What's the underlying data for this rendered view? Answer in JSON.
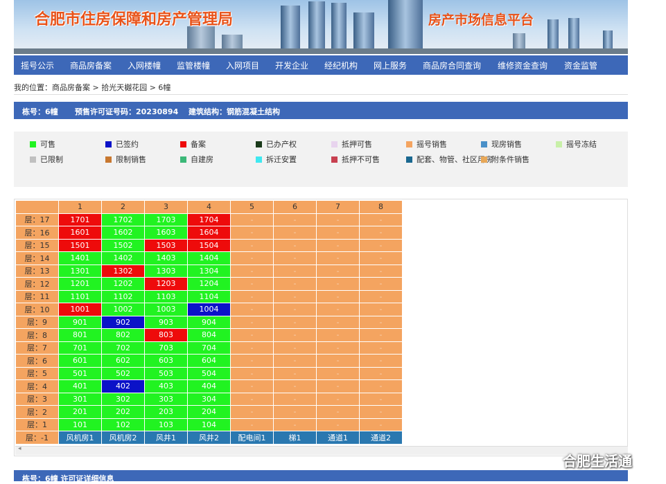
{
  "header": {
    "title": "合肥市住房保障和房产管理局",
    "platform": "房产市场信息平台"
  },
  "nav": [
    "摇号公示",
    "商品房备案",
    "入网楼幢",
    "监管楼幢",
    "入网项目",
    "开发企业",
    "经纪机构",
    "网上服务",
    "商品房合同查询",
    "维修资金查询",
    "资金监管"
  ],
  "breadcrumb": "我的位置：商品房备案 > 拾光天樾花园 > 6幢",
  "info": {
    "building": "栋号：6幢",
    "permit": "预售许可证号码：20230894",
    "structure": "建筑结构：钢筋混凝土结构"
  },
  "legend": [
    {
      "label": "可售",
      "color": "#21f321"
    },
    {
      "label": "已签约",
      "color": "#0b12c8"
    },
    {
      "label": "备案",
      "color": "#ee0b0b"
    },
    {
      "label": "已办产权",
      "color": "#1a3a1a"
    },
    {
      "label": "抵押可售",
      "color": "#e8d4ee"
    },
    {
      "label": "摇号销售",
      "color": "#f4a460"
    },
    {
      "label": "现房销售",
      "color": "#4a90c8"
    },
    {
      "label": "摇号冻结",
      "color": "#c8f0a8"
    },
    {
      "label": "已限制",
      "color": "#c0c0c0"
    },
    {
      "label": "限制销售",
      "color": "#c87830"
    },
    {
      "label": "自建房",
      "color": "#3cb878"
    },
    {
      "label": "拆迁安置",
      "color": "#40e8f0"
    },
    {
      "label": "抵押不可售",
      "color": "#c84050"
    },
    {
      "label": "配套、物管、社区用房",
      "color": "#1a6890"
    },
    {
      "label": "附条件销售",
      "color": "#e8a858"
    }
  ],
  "grid": {
    "columns": [
      "1",
      "2",
      "3",
      "4",
      "5",
      "6",
      "7",
      "8"
    ],
    "empty_mark": "-",
    "floors": [
      {
        "floor": "层：17",
        "units": [
          [
            "1701",
            "red"
          ],
          [
            "1702",
            "green"
          ],
          [
            "1703",
            "green"
          ],
          [
            "1704",
            "red"
          ]
        ]
      },
      {
        "floor": "层：16",
        "units": [
          [
            "1601",
            "red"
          ],
          [
            "1602",
            "green"
          ],
          [
            "1603",
            "green"
          ],
          [
            "1604",
            "red"
          ]
        ]
      },
      {
        "floor": "层：15",
        "units": [
          [
            "1501",
            "red"
          ],
          [
            "1502",
            "green"
          ],
          [
            "1503",
            "red"
          ],
          [
            "1504",
            "red"
          ]
        ]
      },
      {
        "floor": "层：14",
        "units": [
          [
            "1401",
            "green"
          ],
          [
            "1402",
            "green"
          ],
          [
            "1403",
            "green"
          ],
          [
            "1404",
            "green"
          ]
        ]
      },
      {
        "floor": "层：13",
        "units": [
          [
            "1301",
            "green"
          ],
          [
            "1302",
            "red"
          ],
          [
            "1303",
            "green"
          ],
          [
            "1304",
            "green"
          ]
        ]
      },
      {
        "floor": "层：12",
        "units": [
          [
            "1201",
            "green"
          ],
          [
            "1202",
            "green"
          ],
          [
            "1203",
            "red"
          ],
          [
            "1204",
            "green"
          ]
        ]
      },
      {
        "floor": "层：11",
        "units": [
          [
            "1101",
            "green"
          ],
          [
            "1102",
            "green"
          ],
          [
            "1103",
            "green"
          ],
          [
            "1104",
            "green"
          ]
        ]
      },
      {
        "floor": "层：10",
        "units": [
          [
            "1001",
            "red"
          ],
          [
            "1002",
            "green"
          ],
          [
            "1003",
            "green"
          ],
          [
            "1004",
            "blue"
          ]
        ]
      },
      {
        "floor": "层：9",
        "units": [
          [
            "901",
            "green"
          ],
          [
            "902",
            "blue"
          ],
          [
            "903",
            "green"
          ],
          [
            "904",
            "green"
          ]
        ]
      },
      {
        "floor": "层：8",
        "units": [
          [
            "801",
            "green"
          ],
          [
            "802",
            "green"
          ],
          [
            "803",
            "red"
          ],
          [
            "804",
            "green"
          ]
        ]
      },
      {
        "floor": "层：7",
        "units": [
          [
            "701",
            "green"
          ],
          [
            "702",
            "green"
          ],
          [
            "703",
            "green"
          ],
          [
            "704",
            "green"
          ]
        ]
      },
      {
        "floor": "层：6",
        "units": [
          [
            "601",
            "green"
          ],
          [
            "602",
            "green"
          ],
          [
            "603",
            "green"
          ],
          [
            "604",
            "green"
          ]
        ]
      },
      {
        "floor": "层：5",
        "units": [
          [
            "501",
            "green"
          ],
          [
            "502",
            "green"
          ],
          [
            "503",
            "green"
          ],
          [
            "504",
            "green"
          ]
        ]
      },
      {
        "floor": "层：4",
        "units": [
          [
            "401",
            "green"
          ],
          [
            "402",
            "blue"
          ],
          [
            "403",
            "green"
          ],
          [
            "404",
            "green"
          ]
        ]
      },
      {
        "floor": "层：3",
        "units": [
          [
            "301",
            "green"
          ],
          [
            "302",
            "green"
          ],
          [
            "303",
            "green"
          ],
          [
            "304",
            "green"
          ]
        ]
      },
      {
        "floor": "层：2",
        "units": [
          [
            "201",
            "green"
          ],
          [
            "202",
            "green"
          ],
          [
            "203",
            "green"
          ],
          [
            "204",
            "green"
          ]
        ]
      },
      {
        "floor": "层：1",
        "units": [
          [
            "101",
            "green"
          ],
          [
            "102",
            "green"
          ],
          [
            "103",
            "green"
          ],
          [
            "104",
            "green"
          ]
        ]
      }
    ],
    "basement": {
      "floor": "层：-1",
      "units": [
        "风机房1",
        "风机房2",
        "风井1",
        "风井2",
        "配电间1",
        "梯1",
        "通道1",
        "通道2"
      ]
    }
  },
  "bottom_bar": "栋号：6幢 许可证详细信息",
  "watermark": "合肥生活通"
}
